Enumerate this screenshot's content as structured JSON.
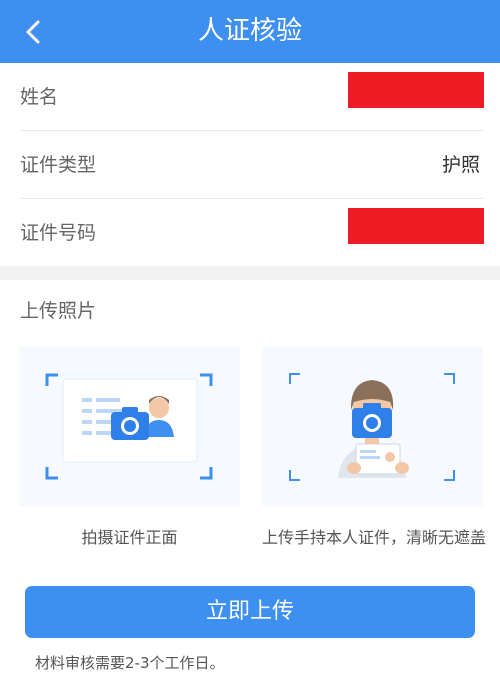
{
  "header": {
    "title": "人证核验",
    "back_icon": "chevron-left-icon"
  },
  "form": {
    "name_label": "姓名",
    "name_value_redacted": true,
    "id_type_label": "证件类型",
    "id_type_value": "护照",
    "id_number_label": "证件号码",
    "id_number_value_redacted": true
  },
  "upload": {
    "section_title": "上传照片",
    "cards": [
      {
        "caption": "拍摄证件正面",
        "illustration": "id-card-camera-icon"
      },
      {
        "caption": "上传手持本人证件，清晰无遮盖",
        "illustration": "person-holding-id-camera-icon"
      }
    ]
  },
  "actions": {
    "submit_label": "立即上传"
  },
  "footer": {
    "note": "材料审核需要2-3个工作日。"
  },
  "colors": {
    "primary": "#3d8ff0",
    "redaction": "#ef1c25",
    "card_bg": "#f6f9ff"
  }
}
